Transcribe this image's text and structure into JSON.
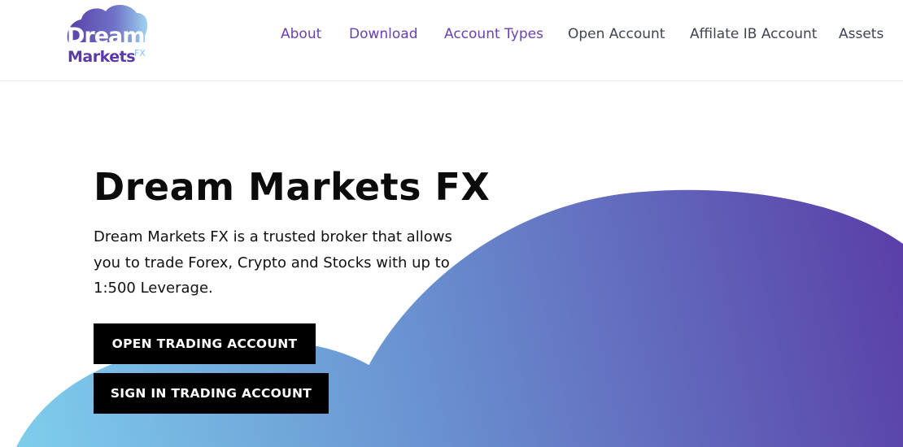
{
  "brand": {
    "logo_word1": "Dream",
    "logo_word2": "Markets",
    "logo_suffix": "FX",
    "colors": {
      "purple": "#6a3fb5",
      "light_blue": "#7fd0ee",
      "deep_purple": "#5a3fa8"
    }
  },
  "nav": {
    "items": [
      {
        "label": "About"
      },
      {
        "label": "Download"
      },
      {
        "label": "Account Types"
      },
      {
        "label": "Open Account"
      },
      {
        "label": "Affilate IB Account"
      },
      {
        "label": "Assets"
      }
    ]
  },
  "hero": {
    "title": "Dream Markets FX",
    "description": "Dream Markets FX is a trusted broker that allows you to trade Forex, Crypto and Stocks with up to 1:500 Leverage.",
    "primary_button": "OPEN TRADING ACCOUNT",
    "secondary_button": "SIGN IN TRADING ACCOUNT",
    "gradient_from": "#7fd0ee",
    "gradient_to": "#5a3fa8"
  }
}
